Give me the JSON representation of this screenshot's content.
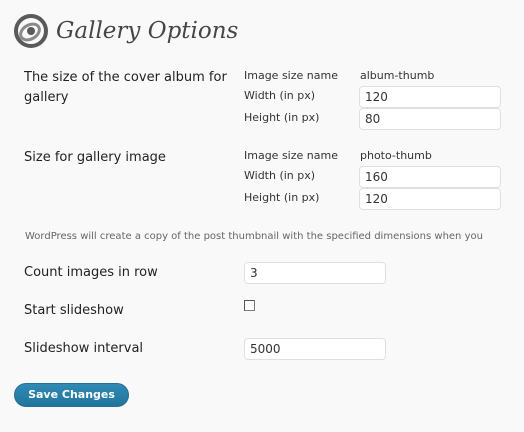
{
  "page": {
    "title": "Gallery Options",
    "icon": "gallery-icon"
  },
  "cover_album": {
    "label": "The size of the cover album for gallery",
    "image_size_name_label": "Image size name",
    "image_size_name_value": "album-thumb",
    "width_label": "Width (in px)",
    "width_value": "120",
    "height_label": "Height (in px)",
    "height_value": "80"
  },
  "gallery_image": {
    "label": "Size for gallery image",
    "image_size_name_label": "Image size name",
    "image_size_name_value": "photo-thumb",
    "width_label": "Width (in px)",
    "width_value": "160",
    "height_label": "Height (in px)",
    "height_value": "120"
  },
  "note": "WordPress will create a copy of the post thumbnail with the specified dimensions when you",
  "count_images": {
    "label": "Count images in row",
    "value": "3"
  },
  "start_slideshow": {
    "label": "Start slideshow",
    "checked": false
  },
  "slideshow_interval": {
    "label": "Slideshow interval",
    "value": "5000"
  },
  "actions": {
    "save_label": "Save Changes"
  },
  "colors": {
    "button_blue": "#21759b",
    "background": "#f9f9f9"
  }
}
